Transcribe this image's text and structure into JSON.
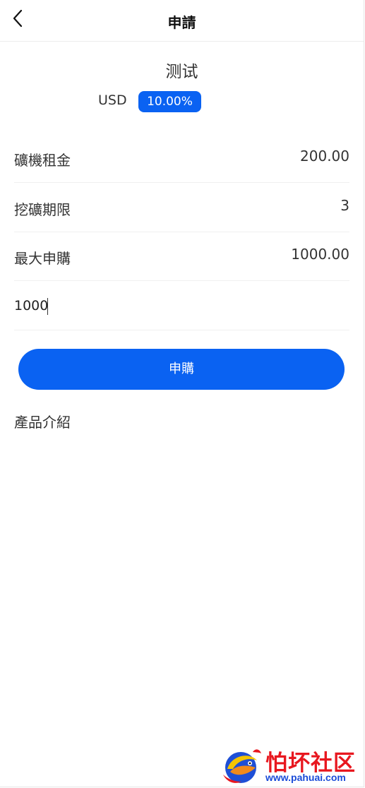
{
  "header": {
    "title": "申請",
    "back_icon": "chevron-left-icon"
  },
  "product": {
    "name": "测试",
    "currency": "USD",
    "rate": "10.00%"
  },
  "details": [
    {
      "label": "礦機租金",
      "value": "200.00"
    },
    {
      "label": "挖礦期限",
      "value": "3"
    },
    {
      "label": "最大申購",
      "value": "1000.00"
    }
  ],
  "amount_input": {
    "value": "1000"
  },
  "subscribe_button": {
    "label": "申購"
  },
  "intro": {
    "heading": "產品介紹"
  },
  "watermark": {
    "title": "怕坏社区",
    "url": "www.pahuai.com"
  },
  "colors": {
    "accent": "#0a62f2",
    "watermark_red": "#e8171f",
    "watermark_blue": "#1a4bd8"
  }
}
